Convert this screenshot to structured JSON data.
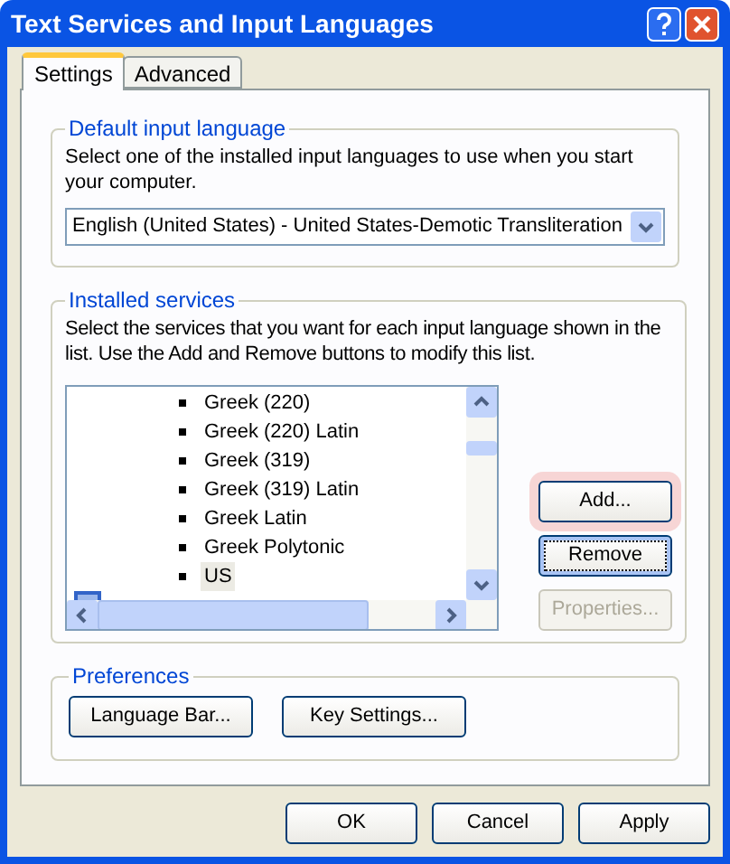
{
  "window": {
    "title": "Text Services and Input Languages"
  },
  "tabs": [
    {
      "label": "Settings",
      "selected": true
    },
    {
      "label": "Advanced",
      "selected": false
    }
  ],
  "default_language": {
    "title": "Default input language",
    "description": "Select one of the installed input languages to use when you start your computer.",
    "value": "English (United States) - United States-Demotic Transliteration"
  },
  "installed_services": {
    "title": "Installed services",
    "description": "Select the services that you want for each input language shown in the list. Use the Add and Remove buttons to modify this list.",
    "items": [
      {
        "label": "Greek (220)",
        "selected": false
      },
      {
        "label": "Greek (220) Latin",
        "selected": false
      },
      {
        "label": "Greek (319)",
        "selected": false
      },
      {
        "label": "Greek (319) Latin",
        "selected": false
      },
      {
        "label": "Greek Latin",
        "selected": false
      },
      {
        "label": "Greek Polytonic",
        "selected": false
      },
      {
        "label": "US",
        "selected": true
      }
    ],
    "buttons": [
      {
        "label": "Add...",
        "hot": true,
        "focused": false,
        "disabled": false
      },
      {
        "label": "Remove",
        "hot": false,
        "focused": true,
        "disabled": false
      },
      {
        "label": "Properties...",
        "hot": false,
        "focused": false,
        "disabled": true
      }
    ]
  },
  "preferences": {
    "title": "Preferences",
    "buttons": [
      "Language Bar...",
      "Key Settings..."
    ]
  },
  "dialog_buttons": [
    "OK",
    "Cancel",
    "Apply"
  ]
}
